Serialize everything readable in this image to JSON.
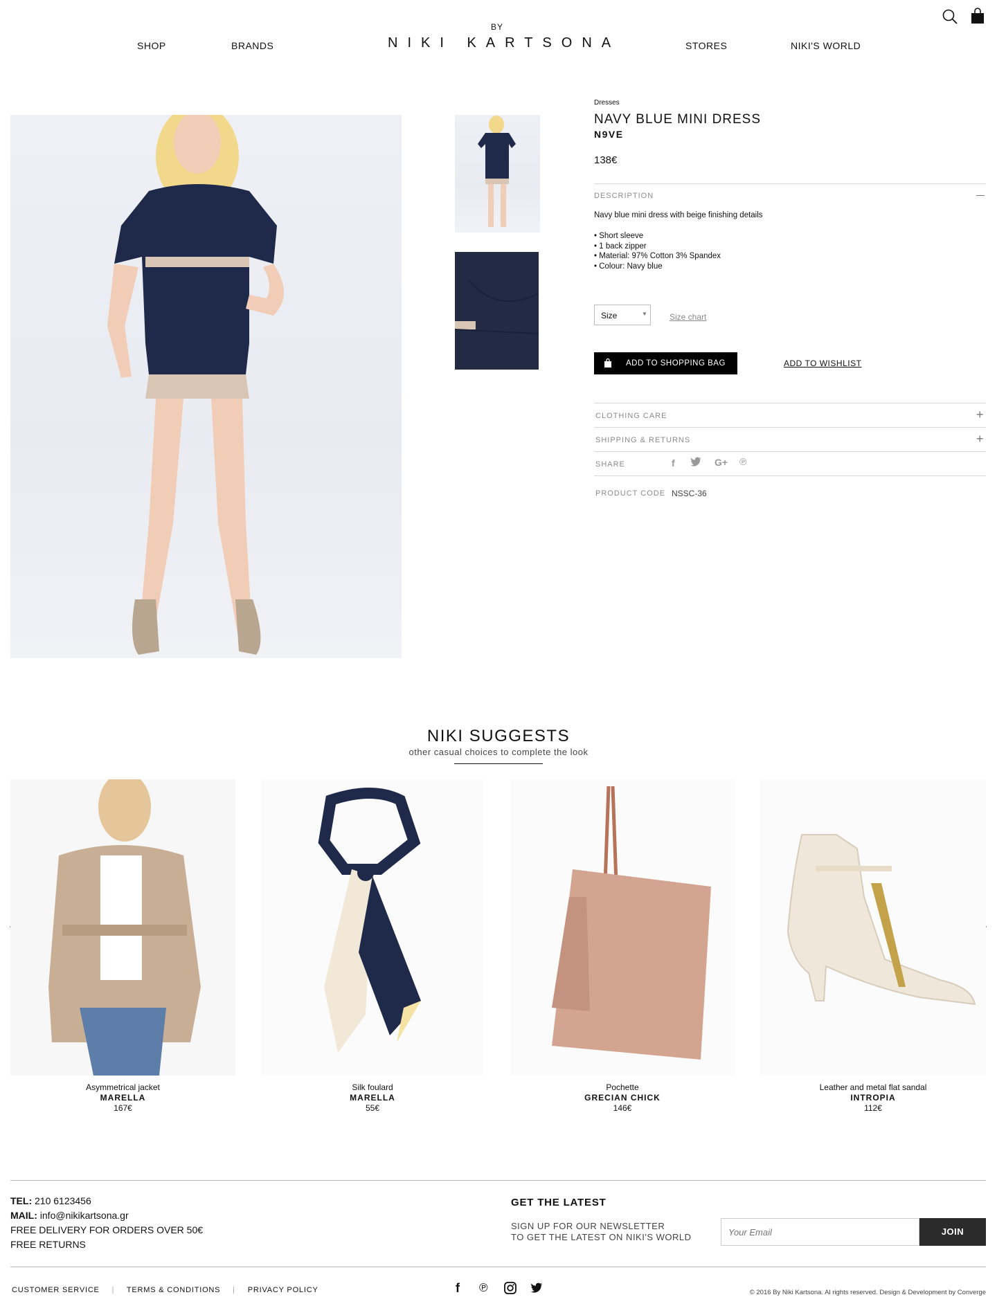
{
  "header": {
    "nav_left": [
      "SHOP",
      "BRANDS"
    ],
    "nav_right": [
      "STORES",
      "NIKI'S WORLD"
    ],
    "logo_by": "BY",
    "logo": "NIKI KARTSONA",
    "icons": [
      "search-icon",
      "shopping-bag-icon"
    ]
  },
  "product": {
    "category": "Dresses",
    "title": "NAVY BLUE MINI DRESS",
    "brand": "N9VE",
    "price": "138€",
    "description_label": "DESCRIPTION",
    "description": "Navy blue mini dress with beige finishing details",
    "bullets": [
      "Short sleeve",
      "1 back zipper",
      "Material: 97% Cotton 3% Spandex",
      "Colour: Navy blue"
    ],
    "size_placeholder": "Size",
    "size_chart": "Size chart",
    "add_to_bag": "ADD TO SHOPPING BAG",
    "add_to_wishlist": "ADD TO WISHLIST",
    "clothing_care": "CLOTHING CARE",
    "shipping_returns": "SHIPPING & RETURNS",
    "share": "SHARE",
    "share_icons": [
      "facebook-icon",
      "twitter-icon",
      "google-plus-icon",
      "pinterest-icon"
    ],
    "product_code_label": "PRODUCT CODE",
    "product_code": "NSSC-36",
    "colors": {
      "dress": "#1f2a4a",
      "trim": "#d9c5b4"
    }
  },
  "suggestions": {
    "title": "NIKI SUGGESTS",
    "subtitle": "other casual choices to complete the look",
    "items": [
      {
        "name": "Asymmetrical jacket",
        "brand": "MARELLA",
        "price": "167€"
      },
      {
        "name": "Silk foulard",
        "brand": "MARELLA",
        "price": "55€"
      },
      {
        "name": "Pochette",
        "brand": "GRECIAN CHICK",
        "price": "146€"
      },
      {
        "name": "Leather and metal flat sandal",
        "brand": "INTROPIA",
        "price": "112€"
      }
    ]
  },
  "footer": {
    "tel_label": "TEL:",
    "tel": "210 6123456",
    "mail_label": "MAIL:",
    "mail": "info@nikikartsona.gr",
    "delivery": "FREE DELIVERY FOR ORDERS OVER 50€",
    "returns": "FREE RETURNS",
    "newsletter_title": "GET THE LATEST",
    "newsletter_line1": "SIGN UP FOR OUR NEWSLETTER",
    "newsletter_line2": "TO GET THE LATEST ON NIKI'S WORLD",
    "email_placeholder": "Your Email",
    "join": "JOIN",
    "links": [
      "CUSTOMER SERVICE",
      "TERMS & CONDITIONS",
      "PRIVACY POLICY"
    ],
    "social_icons": [
      "facebook-icon",
      "pinterest-icon",
      "instagram-icon",
      "twitter-icon"
    ],
    "copyright": "© 2016 By Niki Kartsona. Al rights reserved. Design & Development by Converge"
  }
}
